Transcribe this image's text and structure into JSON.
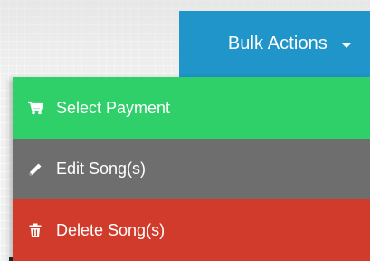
{
  "bulk_actions": {
    "label": "Bulk Actions",
    "caret_icon": "caret-down-icon",
    "color": "#1f95c9"
  },
  "menu": {
    "items": [
      {
        "label": "Select Payment",
        "icon": "cart-icon",
        "color": "#2fcf69"
      },
      {
        "label": "Edit Song(s)",
        "icon": "pencil-icon",
        "color": "#6e6e6e"
      },
      {
        "label": "Delete Song(s)",
        "icon": "trash-icon",
        "color": "#d13b2c"
      }
    ]
  }
}
